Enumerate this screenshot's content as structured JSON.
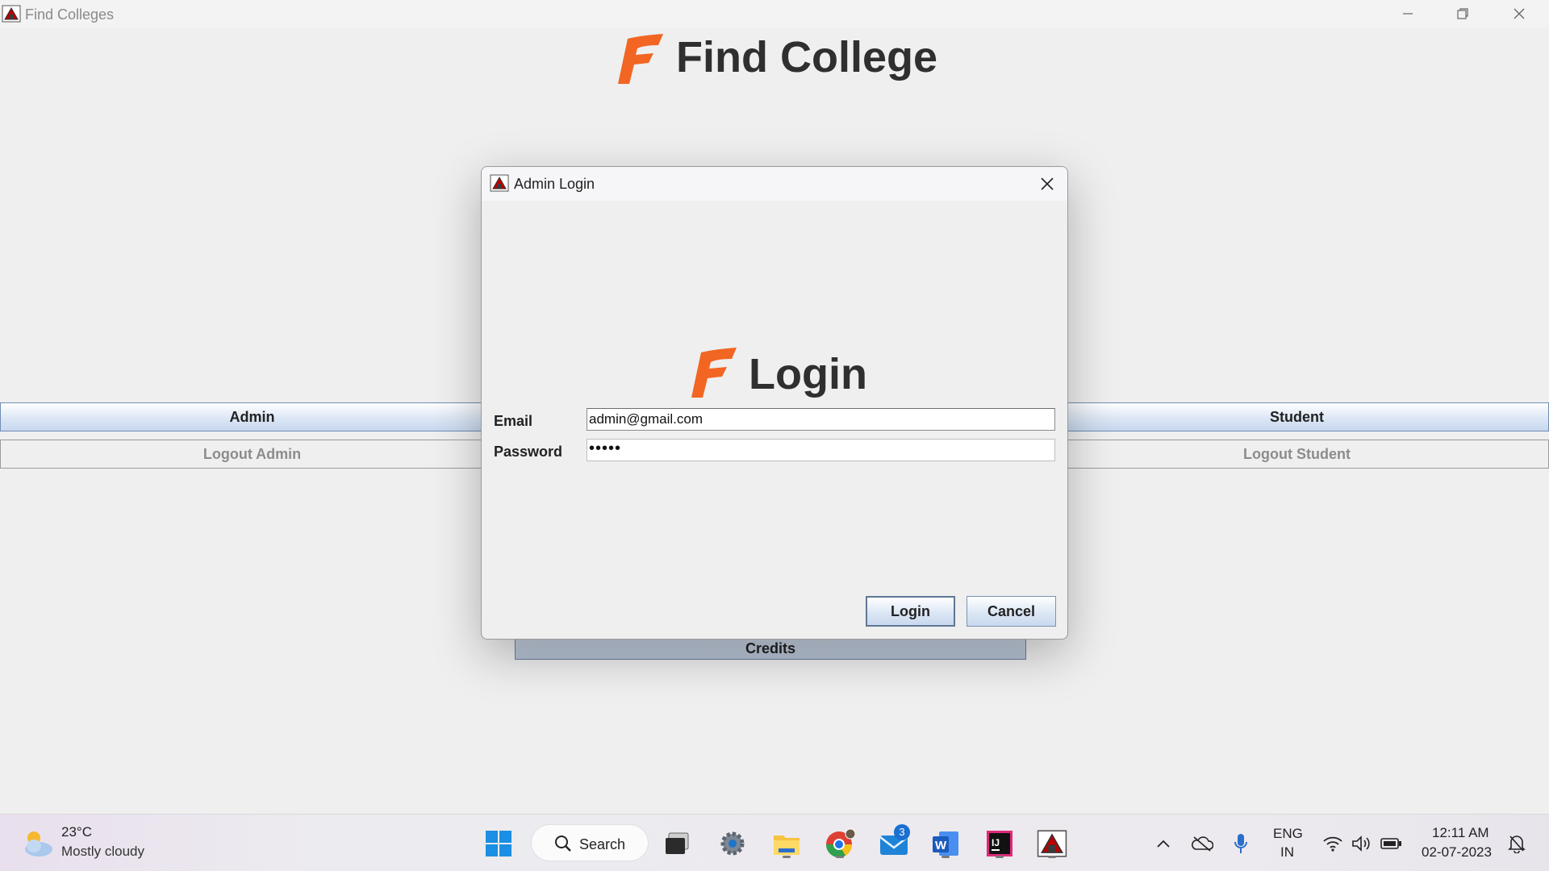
{
  "window": {
    "title": "Find Colleges",
    "header_title": "Find College"
  },
  "main_buttons": {
    "admin": "Admin",
    "student": "Student",
    "logout_admin": "Logout Admin",
    "logout_student": "Logout Student",
    "credits": "Credits"
  },
  "dialog": {
    "title": "Admin Login",
    "heading": "Login",
    "email_label": "Email",
    "email_value": "admin@gmail.com",
    "password_label": "Password",
    "password_value": "•••••",
    "login_button": "Login",
    "cancel_button": "Cancel"
  },
  "taskbar": {
    "temperature": "23°C",
    "condition": "Mostly cloudy",
    "search_label": "Search",
    "mail_badge": "3",
    "lang_top": "ENG",
    "lang_bottom": "IN",
    "time": "12:11 AM",
    "date": "02-07-2023"
  },
  "colors": {
    "accent_orange": "#f26522",
    "button_gradient": "#dce7f5",
    "taskbar": "#eceaee"
  },
  "icons": [
    "java-app-icon",
    "minimize-icon",
    "maximize-icon",
    "close-icon",
    "weather-icon",
    "windows-start-icon",
    "search-icon",
    "task-view-icon",
    "settings-icon",
    "file-explorer-icon",
    "chrome-icon",
    "mail-icon",
    "word-icon",
    "intellij-icon",
    "java-app-icon",
    "chevron-up-icon",
    "onedrive-icon",
    "microphone-icon",
    "wifi-icon",
    "volume-icon",
    "battery-icon",
    "notification-icon"
  ]
}
